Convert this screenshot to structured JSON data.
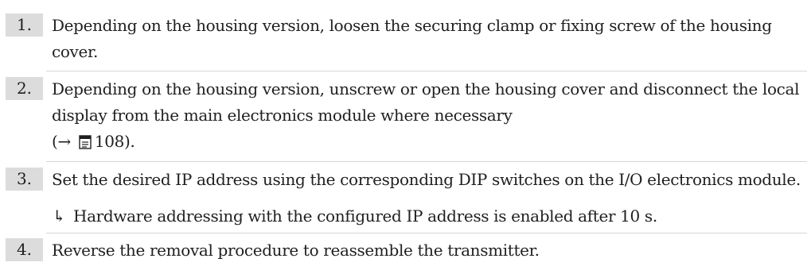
{
  "steps": [
    {
      "num": "1.",
      "text": "Depending on the housing version, loosen the securing clamp or fixing screw of the housing cover."
    },
    {
      "num": "2.",
      "text": "Depending on the housing version, unscrew or open the housing cover and disconnect the local display from the main electronics module where necessary"
    },
    {
      "num": "3.",
      "text": "Set the desired IP address using the corresponding DIP switches on the I/O electronics module."
    },
    {
      "num": "4.",
      "text": "Reverse the removal procedure to reassemble the transmitter."
    }
  ],
  "step2_ref": {
    "open": "(→",
    "page": "108",
    "close": ")."
  },
  "result": {
    "arrow": "↳",
    "text": "Hardware addressing with the configured IP address is enabled after 10 s."
  },
  "icons": {
    "page_ref": "document-page-icon",
    "result": "result-arrow-icon"
  }
}
